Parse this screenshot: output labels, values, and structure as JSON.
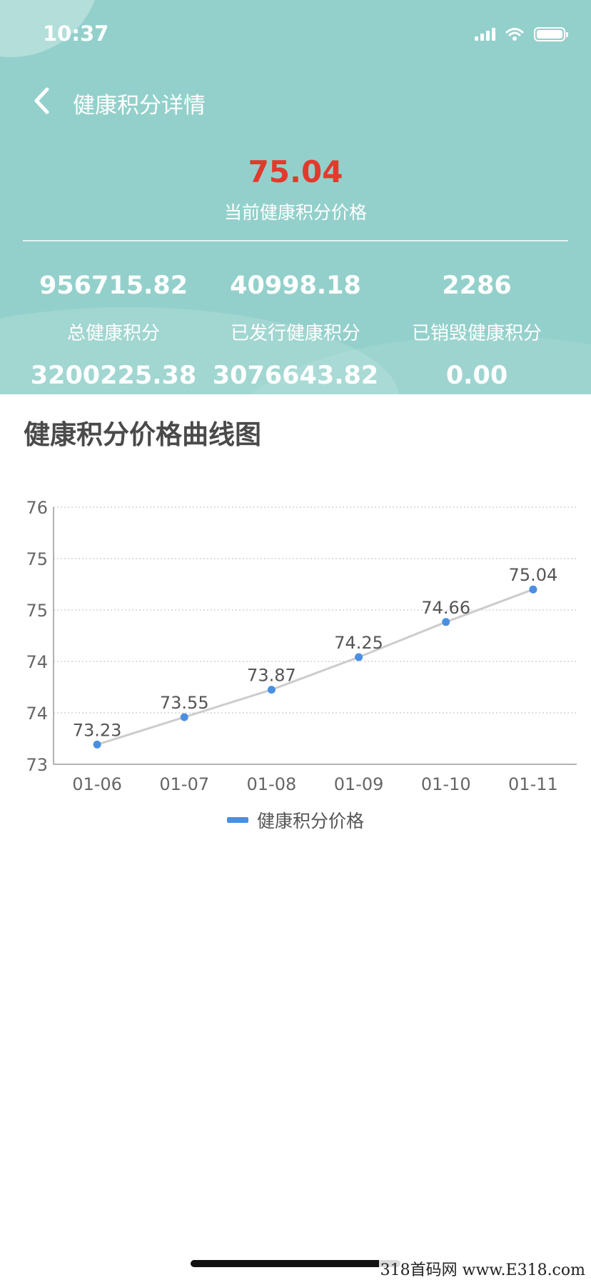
{
  "status_bar": {
    "time": "10:37"
  },
  "nav": {
    "title": "健康积分详情"
  },
  "summary": {
    "current_price": "75.04",
    "current_price_label": "当前健康积分价格",
    "price_color": "#e23a2c"
  },
  "stats": [
    {
      "value": "956715.82",
      "label": "总健康积分",
      "value2": "3200225.38"
    },
    {
      "value": "40998.18",
      "label": "已发行健康积分",
      "value2": "3076643.82"
    },
    {
      "value": "2286",
      "label": "已销毁健康积分",
      "value2": "0.00"
    }
  ],
  "chart_section": {
    "title": "健康积分价格曲线图"
  },
  "chart_data": {
    "type": "line",
    "title": "",
    "categories": [
      "01-06",
      "01-07",
      "01-08",
      "01-09",
      "01-10",
      "01-11"
    ],
    "series": [
      {
        "name": "健康积分价格",
        "values": [
          73.23,
          73.55,
          73.87,
          74.25,
          74.66,
          75.04
        ],
        "color": "#4a8fe2",
        "line_color": "#cccccc"
      }
    ],
    "y_tick_labels": [
      "73",
      "74",
      "74",
      "75",
      "75",
      "76"
    ],
    "ylim": [
      73,
      76
    ],
    "grid": true,
    "legend": "bottom-center",
    "xlabel": "",
    "ylabel": ""
  },
  "watermark": "318首码网  www.E318.com",
  "colors": {
    "header_bg": "#93d0cb",
    "accent": "#4a8fe2"
  }
}
